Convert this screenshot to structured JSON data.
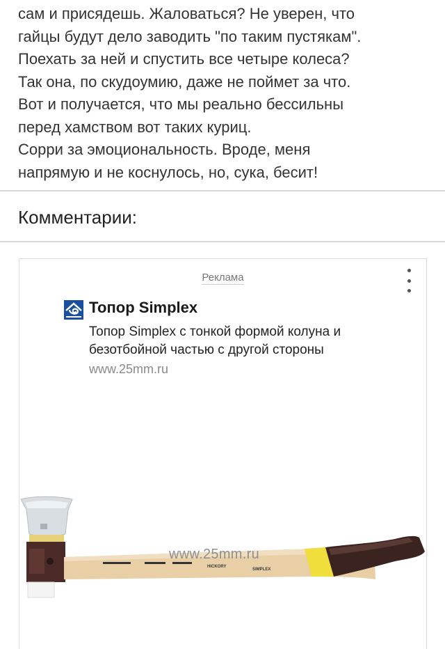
{
  "article": {
    "lines": [
      "сам и присядешь. Жаловаться? Не уверен, что",
      "гайцы будут дело заводить \"по таким пустякам\".",
      "Поехать за ней и спустить все четыре колеса?",
      "Так она, по скудоумию, даже не поймет за что.",
      "Вот и получается, что мы реально бессильны",
      "перед хамством вот таких куриц.",
      "Сорри за эмоциональность. Вроде, меня",
      "напрямую и не коснулось, но, сука, бесит!"
    ]
  },
  "comments": {
    "title": "Комментарии:"
  },
  "ad": {
    "label": "Реклама",
    "menu_icon": "kebab-menu-icon",
    "logo_icon": "advertiser-logo-icon",
    "title": "Топор Simplex",
    "description": "Топор Simplex с тонкой формой колуна и безотбойной частью с другой стороны",
    "url": "www.25mm.ru",
    "image": {
      "watermark": "www.25mm.ru",
      "handle_print_hickory": "HICKORY",
      "handle_print_brand": "SIMPLEX"
    },
    "colors": {
      "logo": "#1a4fa0",
      "handle_wood": "#e8cfa6",
      "handle_grip": "#3b2420",
      "yellow_band": "#f0de3c"
    }
  }
}
